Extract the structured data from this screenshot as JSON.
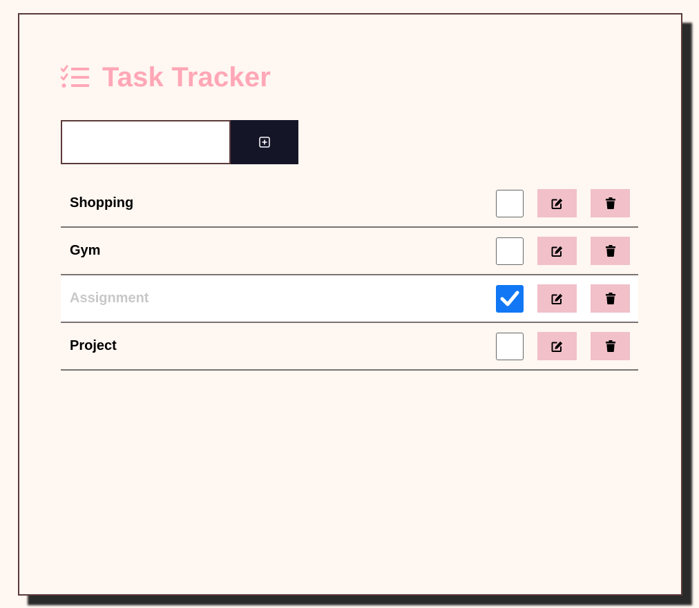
{
  "app": {
    "title": "Task Tracker",
    "title_icon": "list-check-icon",
    "accent_color": "#ffa7b7"
  },
  "add_form": {
    "input_value": "",
    "input_placeholder": "",
    "add_icon": "plus-square-icon"
  },
  "tasks": [
    {
      "label": "Shopping",
      "completed": false
    },
    {
      "label": "Gym",
      "completed": false
    },
    {
      "label": "Assignment",
      "completed": true
    },
    {
      "label": "Project",
      "completed": false
    }
  ],
  "icons": {
    "edit": "edit-icon",
    "delete": "trash-icon",
    "check": "checkmark-icon"
  },
  "colors": {
    "background": "#fff7f1",
    "add_button": "#151528",
    "action_button": "#f1c0c9",
    "checked": "#1177f5",
    "completed_text": "#c8c8c8"
  }
}
